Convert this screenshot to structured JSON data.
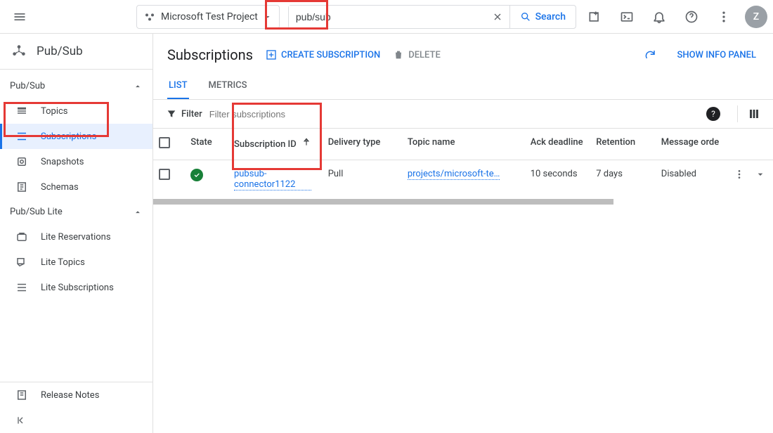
{
  "header": {
    "project_name": "Microsoft Test Project",
    "search_value": "pub/sub",
    "search_button": "Search",
    "avatar_letter": "Z"
  },
  "sidebar": {
    "product": "Pub/Sub",
    "sections": [
      {
        "title": "Pub/Sub",
        "items": [
          "Topics",
          "Subscriptions",
          "Snapshots",
          "Schemas"
        ],
        "active_index": 1
      },
      {
        "title": "Pub/Sub Lite",
        "items": [
          "Lite Reservations",
          "Lite Topics",
          "Lite Subscriptions"
        ]
      }
    ],
    "release_notes": "Release Notes"
  },
  "page": {
    "title": "Subscriptions",
    "create_label": "CREATE SUBSCRIPTION",
    "delete_label": "DELETE",
    "info_panel": "SHOW INFO PANEL"
  },
  "tabs": {
    "list": "LIST",
    "metrics": "METRICS",
    "active": "list"
  },
  "filter": {
    "label": "Filter",
    "placeholder": "Filter subscriptions"
  },
  "table": {
    "columns": {
      "state": "State",
      "subscription_id": "Subscription ID",
      "delivery_type": "Delivery type",
      "topic_name": "Topic name",
      "ack_deadline": "Ack deadline",
      "retention": "Retention",
      "message_ordering": "Message orde"
    },
    "rows": [
      {
        "state": "active",
        "subscription_id": "pubsub-connector1122",
        "delivery_type": "Pull",
        "topic_name": "projects/microsoft-te…",
        "ack_deadline": "10 seconds",
        "retention": "7 days",
        "message_ordering": "Disabled"
      }
    ]
  }
}
